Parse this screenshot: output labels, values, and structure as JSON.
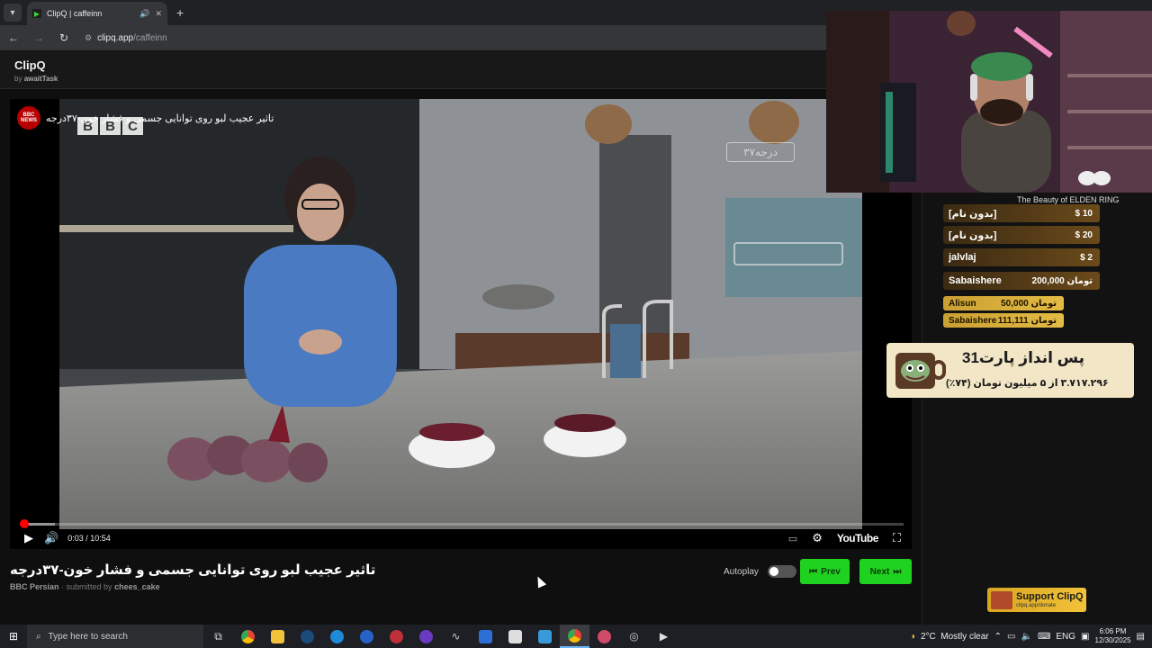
{
  "browser": {
    "tab_title": "ClipQ | caffeinn",
    "new_tab_symbol": "+",
    "url_domain": "clipq.app",
    "url_path": "/caffeinn"
  },
  "site": {
    "brand": "ClipQ",
    "byline_prefix": "by",
    "byline_name": "awaitTask"
  },
  "player": {
    "overlay_title": "تاثیر عجیب لبو روی توانایی جسمی و فشار خون-۳۷درجه",
    "channel_badge": "BBC NEWS",
    "logo_letters": [
      "B",
      "B",
      "C"
    ],
    "watermark": "۳۷درجه",
    "current_time": "0:03",
    "duration": "10:54",
    "time_separator": " / ",
    "played_fraction": 0.005,
    "loaded_fraction": 0.04,
    "youtube_label": "YouTube"
  },
  "video_info": {
    "title": "تاثیر عجیب لبو روی توانایی جسمی و فشار خون-۳۷درجه",
    "channel": "BBC Persian",
    "separator": " · submitted by ",
    "submitter": "chees_cake"
  },
  "queue": {
    "autoplay_label": "Autoplay",
    "autoplay_on": false,
    "prev_label": "Prev",
    "next_label": "Next"
  },
  "overlay_stream": {
    "caption": "The Beauty of ELDEN RING",
    "donations": [
      {
        "name": "[بدون نام]",
        "amount": "$ 10"
      },
      {
        "name": "[بدون نام]",
        "amount": "$ 20"
      },
      {
        "name": "jalvlaj",
        "amount": "$ 2"
      },
      {
        "name": "Sabaishere",
        "amount": "200,000 تومان"
      }
    ],
    "small_donations": [
      {
        "name": "Alisun",
        "amount": "50,000 تومان"
      },
      {
        "name": "Sabaishere",
        "amount": "111,111 تومان"
      }
    ],
    "goal_title": "پس انداز پارت31",
    "goal_subtitle": "۳.۷۱۷.۲۹۶ از ۵ میلیون تومان (۷۴٪)",
    "support_title": "Support ClipQ",
    "support_url": "clipq.app/donate"
  },
  "taskbar": {
    "search_placeholder": "Type here to search",
    "weather": "2°C  Mostly clear",
    "language": "ENG",
    "time": "6:06 PM",
    "date": "12/30/2025"
  },
  "colors": {
    "accent_green": "#1fd21f",
    "progress_red": "#ff0000",
    "bbc_red": "#b80000"
  }
}
